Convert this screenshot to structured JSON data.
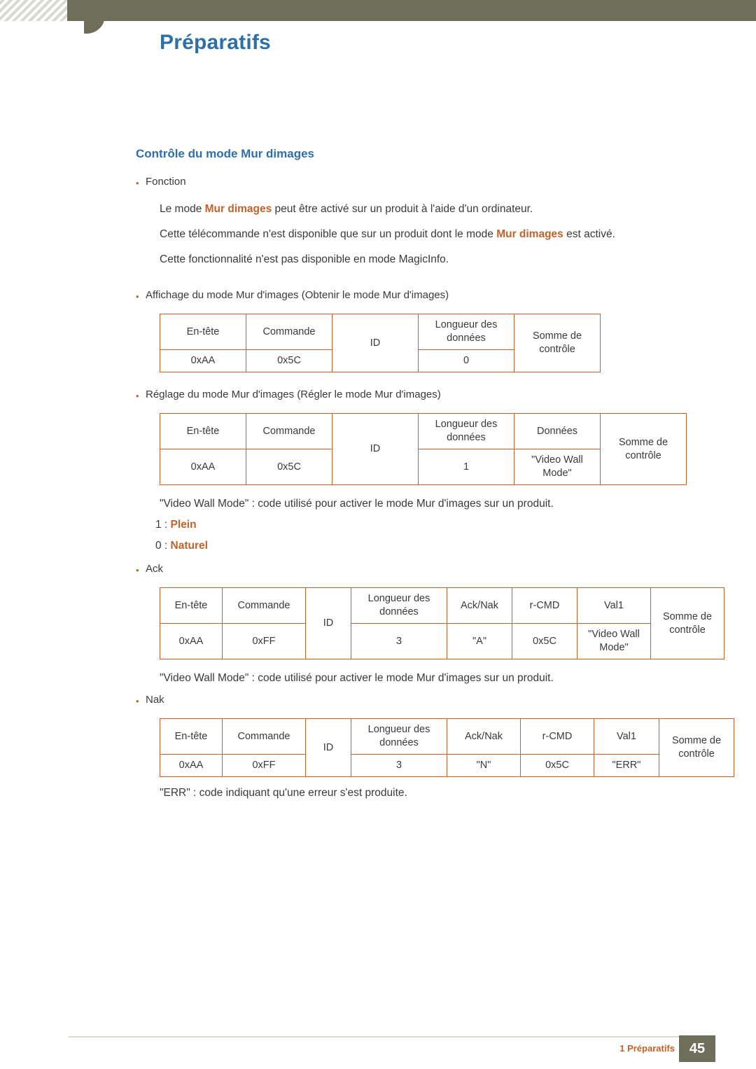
{
  "header": {
    "title": "Préparatifs"
  },
  "section": {
    "title": "Contrôle du mode Mur dimages"
  },
  "bullets": {
    "fonction": "Fonction",
    "affichage": "Affichage du mode Mur d'images (Obtenir le mode Mur d'images)",
    "reglage": "Réglage du mode Mur d'images (Régler le mode Mur d'images)",
    "ack": "Ack",
    "nak": "Nak"
  },
  "paragraphs": {
    "p1_pre": "Le mode ",
    "p1_bold": "Mur dimages",
    "p1_post": " peut être activé sur un produit à l'aide d'un ordinateur.",
    "p2_pre": "Cette télécommande n'est disponible que sur un produit dont le mode ",
    "p2_bold": "Mur dimages",
    "p2_post": " est activé.",
    "p3": "Cette fonctionnalité n'est pas disponible en mode MagicInfo.",
    "videowall_note_1": "\"Video Wall Mode\" : code utilisé pour activer le mode Mur d'images sur un produit.",
    "videowall_note_2": "\"Video Wall Mode\" : code utilisé pour activer le mode Mur d'images sur un produit.",
    "err_note": "\"ERR\" : code indiquant qu'une erreur s'est produite."
  },
  "legend": {
    "one_prefix": "1 : ",
    "one_value": "Plein",
    "zero_prefix": "0 : ",
    "zero_value": "Naturel"
  },
  "tables": {
    "get": {
      "headers": [
        "En-tête",
        "Commande",
        "ID",
        "Longueur des données",
        "Somme de contrôle"
      ],
      "values": [
        "0xAA",
        "0x5C",
        "",
        "0",
        ""
      ]
    },
    "set": {
      "headers": [
        "En-tête",
        "Commande",
        "ID",
        "Longueur des données",
        "Données",
        "Somme de contrôle"
      ],
      "values": [
        "0xAA",
        "0x5C",
        "",
        "1",
        "\"Video Wall Mode\"",
        ""
      ]
    },
    "ack": {
      "headers": [
        "En-tête",
        "Commande",
        "ID",
        "Longueur des données",
        "Ack/Nak",
        "r-CMD",
        "Val1",
        "Somme de contrôle"
      ],
      "values": [
        "0xAA",
        "0xFF",
        "",
        "3",
        "\"A\"",
        "0x5C",
        "\"Video Wall Mode\"",
        ""
      ]
    },
    "nak": {
      "headers": [
        "En-tête",
        "Commande",
        "ID",
        "Longueur des données",
        "Ack/Nak",
        "r-CMD",
        "Val1",
        "Somme de contrôle"
      ],
      "values": [
        "0xAA",
        "0xFF",
        "",
        "3",
        "\"N\"",
        "0x5C",
        "\"ERR\"",
        ""
      ]
    }
  },
  "footer": {
    "label": "1 Préparatifs",
    "page": "45"
  }
}
